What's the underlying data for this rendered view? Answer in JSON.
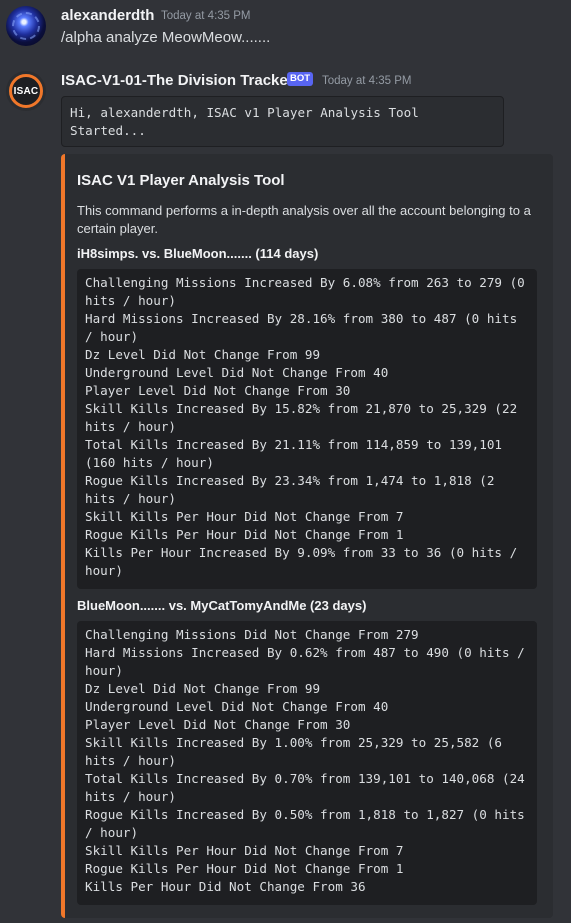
{
  "messages": [
    {
      "author": "alexanderdth",
      "timestamp": "Today at 4:35 PM",
      "text": "/alpha analyze MeowMeow......."
    },
    {
      "author": "ISAC-V1-01-The Division Tracker",
      "badge": "BOT",
      "avatar_text": "ISAC",
      "timestamp": "Today at 4:35 PM",
      "code_text": "Hi, alexanderdth, ISAC v1 Player Analysis Tool\nStarted..."
    }
  ],
  "embed": {
    "accent_color": "#f0772a",
    "title": "ISAC V1 Player Analysis Tool",
    "description": "This command performs a in-depth analysis over all the account belonging to a certain player.",
    "fields": [
      {
        "name": "iH8simps. vs. BlueMoon....... (114 days)",
        "lines": [
          "Challenging Missions Increased By 6.08% from 263 to 279 (0 hits / hour)",
          "Hard Missions Increased By 28.16% from 380 to 487 (0 hits / hour)",
          "Dz Level Did Not Change From 99",
          "Underground Level Did Not Change From 40",
          "Player Level Did Not Change From 30",
          "Skill Kills Increased By 15.82% from 21,870 to 25,329 (22 hits / hour)",
          "Total Kills Increased By 21.11% from 114,859 to 139,101 (160 hits / hour)",
          "Rogue Kills Increased By 23.34% from 1,474 to 1,818 (2 hits / hour)",
          "Skill Kills Per Hour Did Not Change From 7",
          "Rogue Kills Per Hour Did Not Change From 1",
          "Kills Per Hour Increased By 9.09% from 33 to 36 (0 hits / hour)"
        ]
      },
      {
        "name": "BlueMoon....... vs. MyCatTomyAndMe (23 days)",
        "lines": [
          "Challenging Missions Did Not Change From 279",
          "Hard Missions Increased By 0.62% from 487 to 490 (0 hits / hour)",
          "Dz Level Did Not Change From 99",
          "Underground Level Did Not Change From 40",
          "Player Level Did Not Change From 30",
          "Skill Kills Increased By 1.00% from 25,329 to 25,582 (6 hits / hour)",
          "Total Kills Increased By 0.70% from 139,101 to 140,068 (24 hits / hour)",
          "Rogue Kills Increased By 0.50% from 1,818 to 1,827 (0 hits / hour)",
          "Skill Kills Per Hour Did Not Change From 7",
          "Rogue Kills Per Hour Did Not Change From 1",
          "Kills Per Hour Did Not Change From 36"
        ]
      }
    ]
  }
}
